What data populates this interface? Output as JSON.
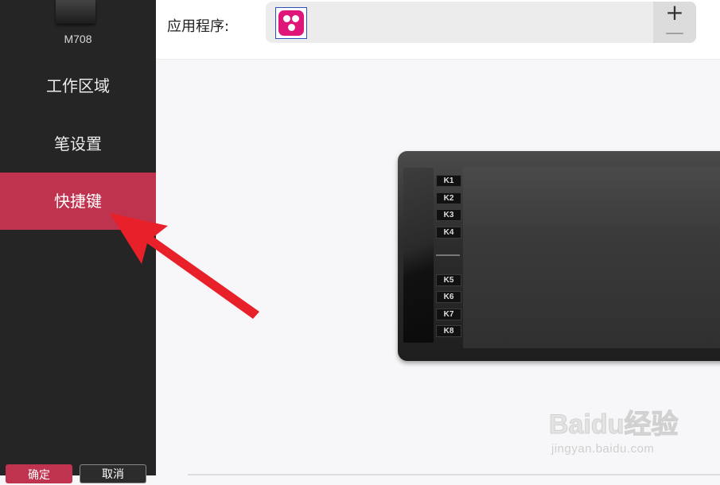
{
  "sidebar": {
    "device_name": "M708",
    "items": [
      {
        "label": "工作区域"
      },
      {
        "label": "笔设置"
      },
      {
        "label": "快捷键",
        "active": true
      }
    ],
    "ok_label": "确定",
    "cancel_label": "取消"
  },
  "header": {
    "app_label": "应用程序:",
    "plus_label": "+",
    "minus_label": "—"
  },
  "tablet": {
    "keys": [
      "K1",
      "K2",
      "K3",
      "K4",
      "K5",
      "K6",
      "K7",
      "K8"
    ]
  },
  "watermark": {
    "brand": "Baidu经验",
    "url": "jingyan.baidu.com"
  },
  "colors": {
    "accent": "#c0334f",
    "sidebar_bg": "#252525",
    "arrow": "#e8202a",
    "app_icon": "#e0157a"
  },
  "icons": {
    "app_icon": "three-dots-app-icon",
    "device": "tablet-device-icon"
  }
}
